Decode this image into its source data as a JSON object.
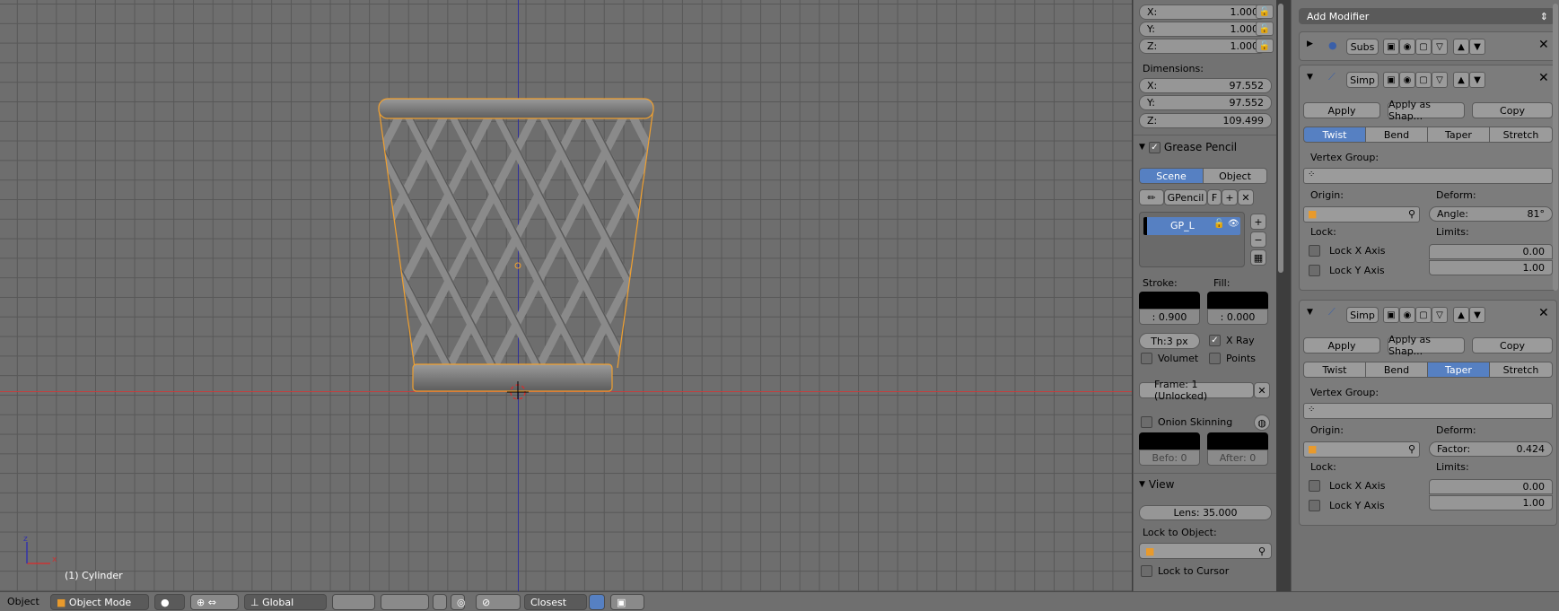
{
  "viewport": {
    "object_info": "(1) Cylinder"
  },
  "npanel": {
    "scale": {
      "x_label": "X:",
      "x": "1.000",
      "y_label": "Y:",
      "y": "1.000",
      "z_label": "Z:",
      "z": "1.000"
    },
    "dimensions_label": "Dimensions:",
    "dimensions": {
      "x_label": "X:",
      "x": "97.552",
      "y_label": "Y:",
      "y": "97.552",
      "z_label": "Z:",
      "z": "109.499"
    },
    "grease_pencil": {
      "title": "Grease Pencil",
      "tab_scene": "Scene",
      "tab_object": "Object",
      "gpencil_name": "GPencil",
      "f_label": "F",
      "layer_name": "GP_L",
      "stroke_label": "Stroke:",
      "fill_label": "Fill:",
      "stroke_value": ": 0.900",
      "fill_value": ": 0.000",
      "thickness": "Th:3 px",
      "xray": "X Ray",
      "volumetric": "Volumet",
      "points": "Points",
      "frame": "Frame: 1 (Unlocked)",
      "onion": "Onion Skinning",
      "before": "Befo: 0",
      "after": "After: 0"
    },
    "view": {
      "title": "View",
      "lens_label": "Lens:",
      "lens": "35.000",
      "lock_object": "Lock to Object:",
      "lock_cursor": "Lock to Cursor"
    }
  },
  "modifiers": {
    "add_label": "Add Modifier",
    "subsurf": {
      "name": "Subs"
    },
    "m1": {
      "name": "Simp",
      "apply": "Apply",
      "apply_shape": "Apply as Shap...",
      "copy": "Copy",
      "tabs": [
        "Twist",
        "Bend",
        "Taper",
        "Stretch"
      ],
      "active": "Twist",
      "vgroup": "Vertex Group:",
      "origin": "Origin:",
      "deform": "Deform:",
      "param_label": "Angle:",
      "param": "81°",
      "lock": "Lock:",
      "limits": "Limits:",
      "lock_x": "Lock X Axis",
      "lock_y": "Lock Y Axis",
      "limit1": "0.00",
      "limit2": "1.00"
    },
    "m2": {
      "name": "Simp",
      "apply": "Apply",
      "apply_shape": "Apply as Shap...",
      "copy": "Copy",
      "tabs": [
        "Twist",
        "Bend",
        "Taper",
        "Stretch"
      ],
      "active": "Taper",
      "vgroup": "Vertex Group:",
      "origin": "Origin:",
      "deform": "Deform:",
      "param_label": "Factor:",
      "param": "0.424",
      "lock": "Lock:",
      "limits": "Limits:",
      "lock_x": "Lock X Axis",
      "lock_y": "Lock Y Axis",
      "limit1": "0.00",
      "limit2": "1.00"
    }
  },
  "header": {
    "object": "Object",
    "mode": "Object Mode",
    "orientation": "Global",
    "snap": "Closest"
  },
  "colors": {
    "accent": "#5680c2",
    "selection": "#f0a030",
    "grid": "#6e6e6e"
  }
}
